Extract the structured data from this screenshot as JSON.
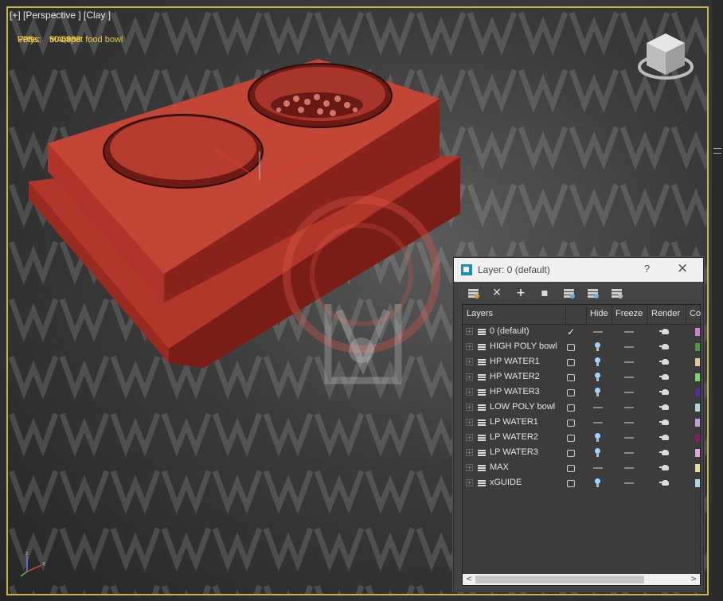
{
  "viewport": {
    "label": "[+] [Perspective ] [Clay ]",
    "object_name": "MAX pet food bowl",
    "stats": [
      {
        "key": "Polys:",
        "value": "504,688"
      },
      {
        "key": "Verts:",
        "value": "504,463"
      }
    ],
    "fps": {
      "key": "FPS:",
      "value": "30.590"
    },
    "accent_color": "#c9b34a",
    "model_color": "#a83226"
  },
  "layer_dialog": {
    "title": "Layer: 0 (default)",
    "help_label": "?",
    "close_label": "×",
    "toolbar": [
      "new-layer-icon",
      "delete-icon",
      "add-selection-icon",
      "select-icon",
      "highlight-layer-icon",
      "hide-all-icon",
      "freeze-all-icon"
    ],
    "columns": {
      "layers": "Layers",
      "hide": "Hide",
      "freeze": "Freeze",
      "render": "Render",
      "color": "Co"
    },
    "rows": [
      {
        "name": "0 (default)",
        "active": true,
        "hidden": false,
        "color": "#d77ad4"
      },
      {
        "name": "HIGH POLY bowl",
        "active": false,
        "hidden": true,
        "color": "#4a9c3c"
      },
      {
        "name": "HP WATER1",
        "active": false,
        "hidden": true,
        "color": "#e8c49a"
      },
      {
        "name": "HP WATER2",
        "active": false,
        "hidden": true,
        "color": "#7ad46a"
      },
      {
        "name": "HP WATER3",
        "active": false,
        "hidden": true,
        "color": "#5a2aa0"
      },
      {
        "name": "LOW POLY bowl",
        "active": false,
        "hidden": false,
        "color": "#a8d6d0"
      },
      {
        "name": "LP WATER1",
        "active": false,
        "hidden": false,
        "color": "#c898e0"
      },
      {
        "name": "LP WATER2",
        "active": false,
        "hidden": true,
        "color": "#8a1a6a"
      },
      {
        "name": "LP WATER3",
        "active": false,
        "hidden": true,
        "color": "#e6a2d8"
      },
      {
        "name": "MAX",
        "active": false,
        "hidden": false,
        "color": "#e8e090"
      },
      {
        "name": "xGUIDE",
        "active": false,
        "hidden": true,
        "color": "#a8d8e8"
      }
    ],
    "scroll_left": "<",
    "scroll_right": ">"
  }
}
